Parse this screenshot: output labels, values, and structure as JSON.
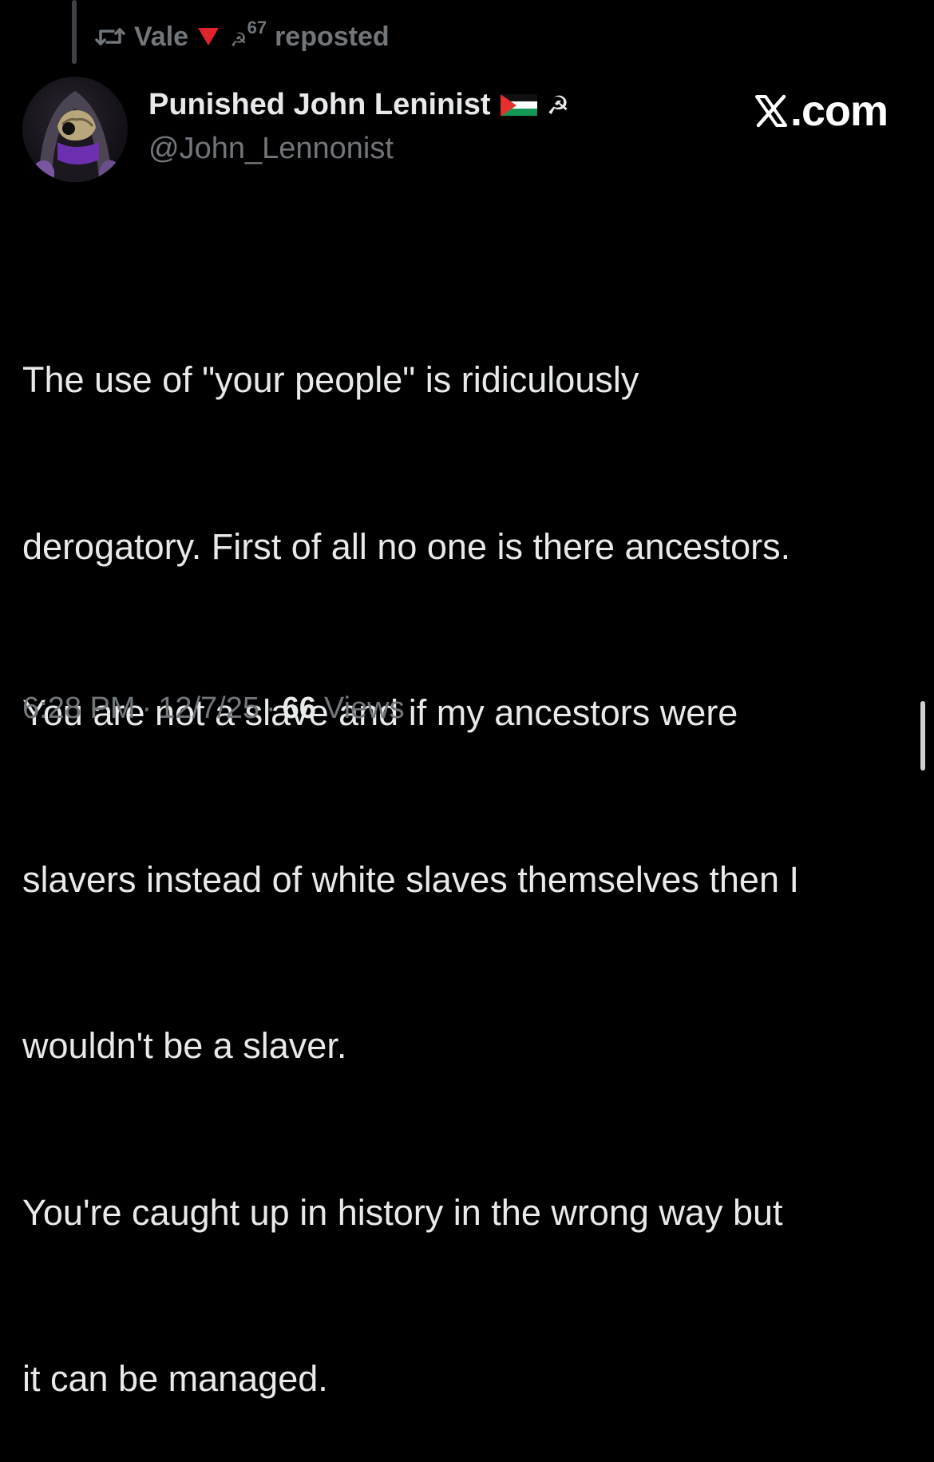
{
  "repost": {
    "reposter_name": "Vale",
    "badge_text": "67",
    "suffix": "reposted",
    "icon": "repost-icon"
  },
  "author": {
    "display_name": "Punished John Leninist",
    "handle": "@John_Lennonist",
    "flag_icon": "palestine-flag-icon",
    "symbol_icon": "hammer-sickle-icon",
    "avatar_icon": "avatar"
  },
  "watermark": {
    "text": ".com",
    "logo_icon": "x-logo-icon"
  },
  "tweet": {
    "lines": [
      "The use of \"your people\" is ridiculously",
      "derogatory. First of all no one is there ancestors.",
      "You are not a slave and if my ancestors were",
      "slavers instead of white slaves themselves then I",
      "wouldn't be a slaver.",
      "You're caught up in history in the wrong way but",
      "it can be managed."
    ]
  },
  "meta": {
    "time": "6:28 PM",
    "separator": "·",
    "date": "12/7/25",
    "views_count": "66",
    "views_label": "Views"
  },
  "colors": {
    "background": "#000000",
    "primary_text": "#e7e9ea",
    "secondary_text": "#71767b",
    "red_triangle": "#e0242b"
  }
}
